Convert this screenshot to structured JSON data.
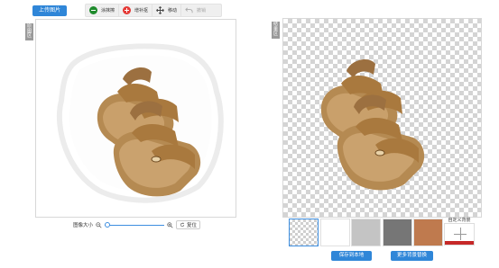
{
  "toolbar": {
    "upload_label": "上传图片",
    "erase_label": "涂抹擦",
    "keep_label": "增补抠",
    "move_label": "移动",
    "undo_label": "撤销"
  },
  "left_panel": {
    "tag": "原图区"
  },
  "right_panel": {
    "tag": "结果区"
  },
  "zoom": {
    "label": "图像大小",
    "value": 0,
    "reset_label": "复位"
  },
  "backgrounds": {
    "swatches": [
      {
        "name": "transparent",
        "color": "transparent"
      },
      {
        "name": "white",
        "color": "#ffffff"
      },
      {
        "name": "light-gray",
        "color": "#c4c4c4"
      },
      {
        "name": "dark-gray",
        "color": "#767676"
      },
      {
        "name": "brown",
        "color": "#bf7a4e"
      }
    ],
    "selected": "transparent",
    "custom_label": "自定义背景"
  },
  "actions": {
    "save_label": "保存到本地",
    "more_label": "更多背景替换"
  },
  "colors": {
    "accent": "#2f86d8",
    "erase": "#1e8b2c",
    "keep": "#e53935",
    "custom_bar": "#c62828"
  }
}
